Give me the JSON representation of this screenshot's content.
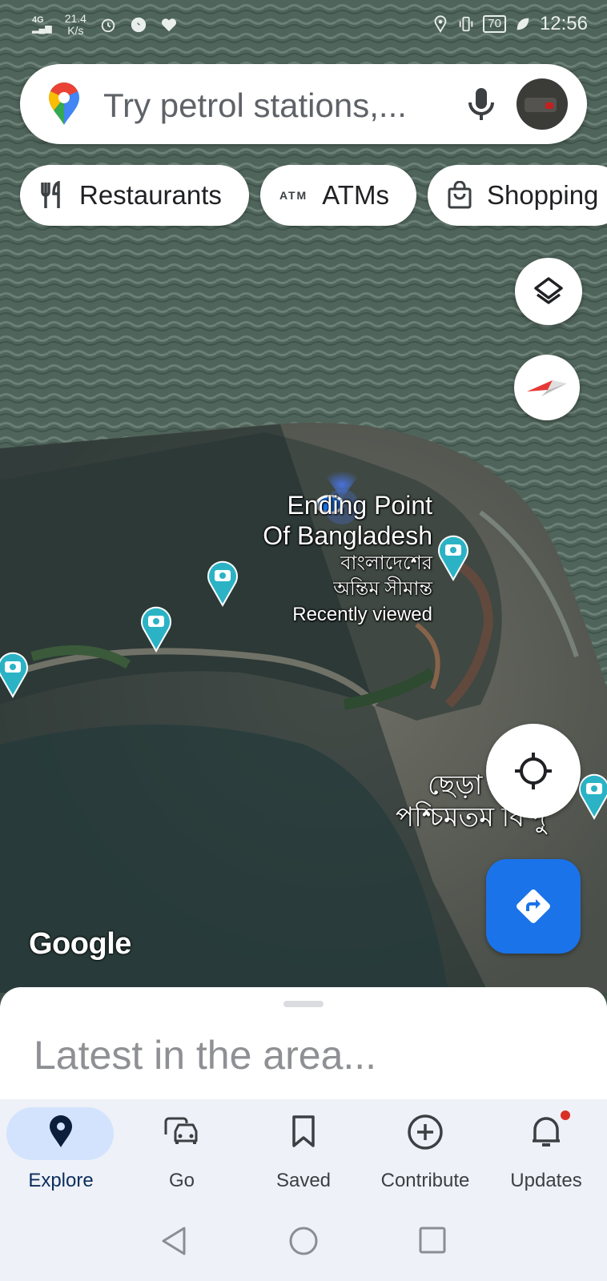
{
  "status_bar": {
    "network": "4G",
    "speed_value": "21.4",
    "speed_unit": "K/s",
    "battery": "70",
    "time": "12:56"
  },
  "search": {
    "placeholder": "Try petrol stations,...",
    "icons": [
      "maps-pin-icon",
      "microphone-icon",
      "avatar"
    ]
  },
  "chips": [
    {
      "label": "Restaurants",
      "icon": "fork-knife-icon"
    },
    {
      "label": "ATMs",
      "icon_text": "ATM"
    },
    {
      "label": "Shopping",
      "icon": "shopping-bag-icon"
    }
  ],
  "map": {
    "place_primary": {
      "name_line1": "Ending Point",
      "name_line2": "Of Bangladesh",
      "local_line1": "বাংলাদেশের",
      "local_line2": "অন্তিম সীমান্ত",
      "note": "Recently viewed"
    },
    "place_secondary": {
      "line1": "ছেড়া",
      "line2": "পশ্চিমতম বিন্দু"
    },
    "watermark": "Google",
    "accent_color": "#1a73e8",
    "photo_pin_color": "#2bb3c5"
  },
  "bottom_sheet": {
    "title": "Latest in the area..."
  },
  "bottom_nav": {
    "items": [
      {
        "label": "Explore",
        "icon": "location-pin-icon",
        "active": true
      },
      {
        "label": "Go",
        "icon": "car-icon",
        "active": false
      },
      {
        "label": "Saved",
        "icon": "bookmark-icon",
        "active": false
      },
      {
        "label": "Contribute",
        "icon": "add-circle-icon",
        "active": false
      },
      {
        "label": "Updates",
        "icon": "bell-icon",
        "active": false,
        "badge": true
      }
    ]
  }
}
